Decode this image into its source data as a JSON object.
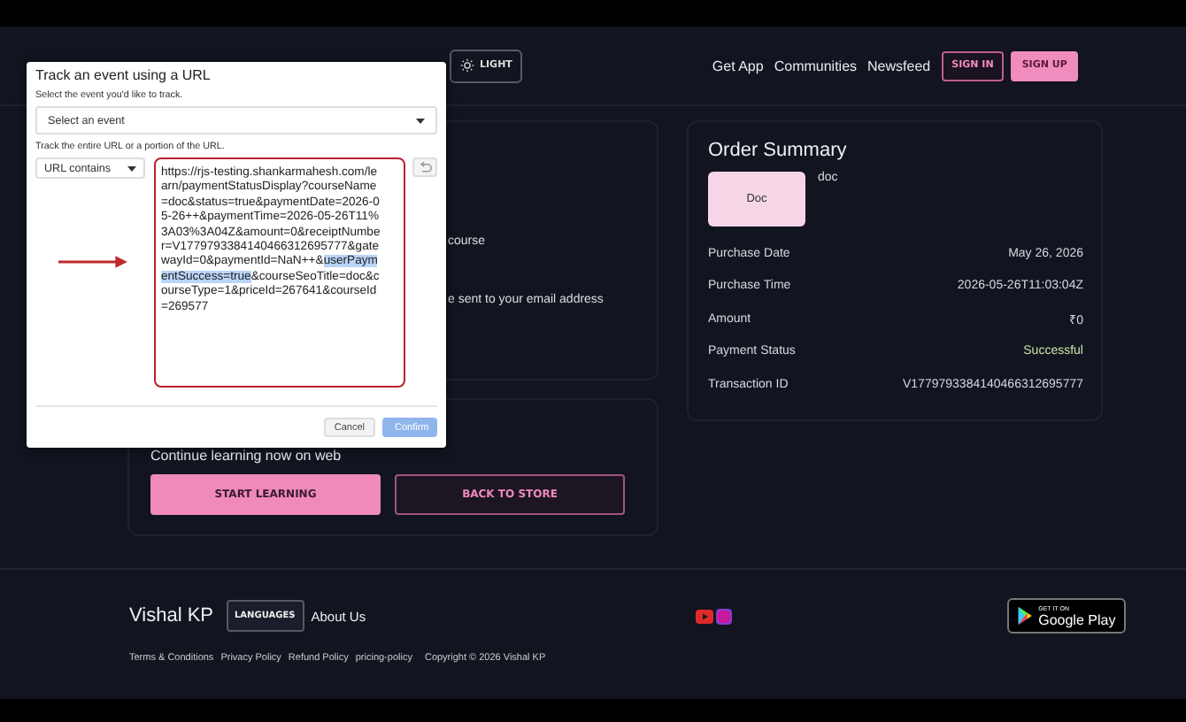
{
  "header": {
    "theme_button": "LIGHT",
    "nav": [
      "Get App",
      "Communities",
      "Newsfeed"
    ],
    "sign_in": "SIGN IN",
    "sign_up": "SIGN UP"
  },
  "info_card": {
    "lines": [
      "course",
      "e sent to your email address"
    ]
  },
  "continue_card": {
    "title": "Continue learning now on web",
    "primary": "START LEARNING",
    "secondary": "BACK TO STORE"
  },
  "order_summary": {
    "title": "Order Summary",
    "thumbnail": "Doc",
    "course": "doc",
    "rows": [
      {
        "label": "Purchase Date",
        "value": "May 26, 2026",
        "kind": "plain"
      },
      {
        "label": "Purchase Time",
        "value": "2026-05-26T11:03:04Z",
        "kind": "plain"
      },
      {
        "label": "Amount",
        "value": "₹0",
        "kind": "plain"
      },
      {
        "label": "Payment Status",
        "value": "Successful",
        "kind": "status"
      },
      {
        "label": "Transaction ID",
        "value": "V1779793384140466312695777",
        "kind": "plain"
      }
    ]
  },
  "footer": {
    "brand": "Vishal KP",
    "languages": "LANGUAGES",
    "about": "About Us",
    "store_badge": {
      "small": "GET IT ON",
      "large": "Google Play"
    },
    "links": [
      "Terms & Conditions",
      "Privacy Policy",
      "Refund Policy",
      "pricing-policy"
    ],
    "copyright": "Copyright © 2026 Vishal KP"
  },
  "dialog": {
    "title": "Track an event using a URL",
    "event_label": "Select the event you'd like to track.",
    "event_select": "Select an event",
    "match_label": "Track the entire URL or a portion of the URL.",
    "match_select": "URL contains",
    "url_parts": [
      {
        "text": "https://rjs-testing.shankarmahesh.com/learn/paymentStatusDisplay?courseName=doc&status=true&paymentDate=2026-05-26++&paymentTime=2026-05-26T11%3A03%3A04Z&amount=0&receiptNumber=V1779793384140466312695777&gatewayId=0&paymentId=NaN++&",
        "selected": false
      },
      {
        "text": "userPaymentSuccess=true",
        "selected": true
      },
      {
        "text": "&courseSeoTitle=doc&courseType=1&priceId=267641&courseId=269577",
        "selected": false
      }
    ],
    "cancel": "Cancel",
    "confirm": {
      "label": "Confirm",
      "disabled": true
    }
  }
}
